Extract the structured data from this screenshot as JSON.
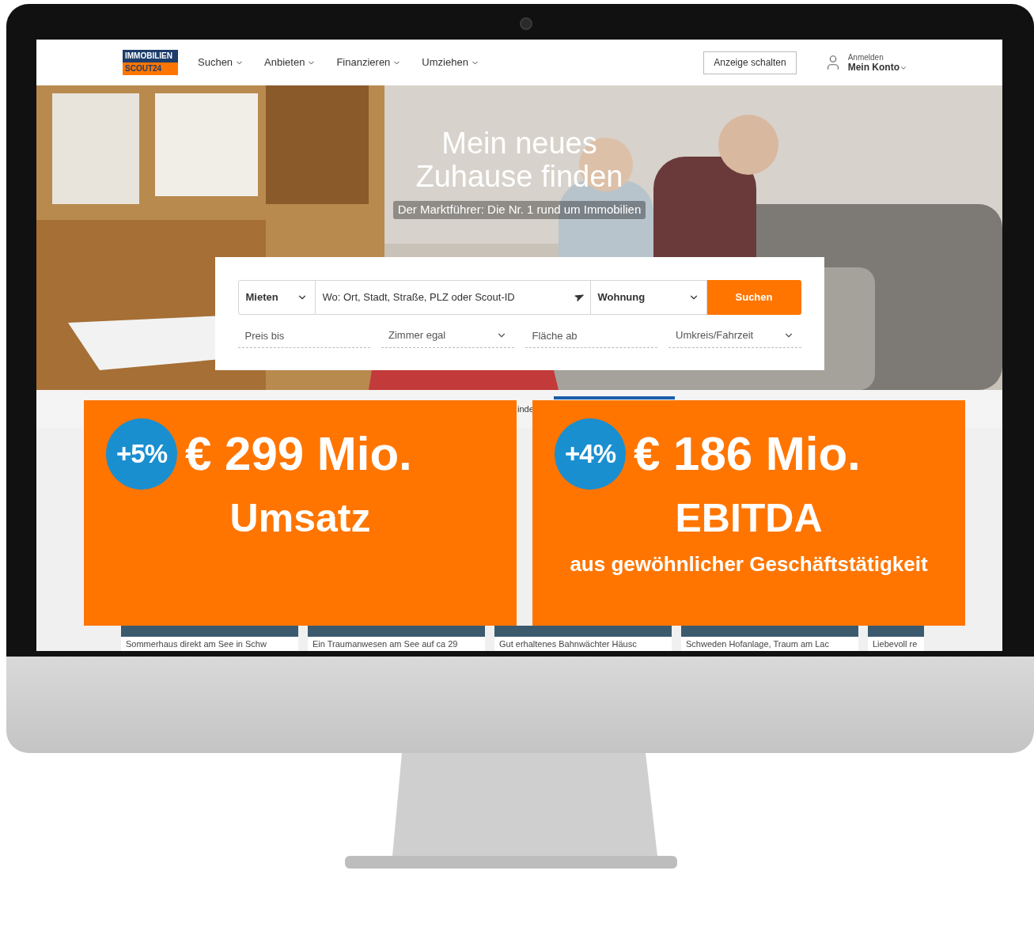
{
  "logo": {
    "line_1": "IMMOBILIEN",
    "line_2": "SCOUT24"
  },
  "nav": [
    {
      "label": "Suchen"
    },
    {
      "label": "Anbieten"
    },
    {
      "label": "Finanzieren"
    },
    {
      "label": "Umziehen"
    }
  ],
  "header_button": "Anzeige schalten",
  "account": {
    "hint": "Anmelden",
    "label": "Mein Konto"
  },
  "hero": {
    "title_lines": [
      "Mein neues",
      "Zuhause finden"
    ],
    "subtitle": "Der Marktführer: Die Nr. 1 rund um Immobilien"
  },
  "search": {
    "mode": "Mieten",
    "location_placeholder": "Wo: Ort, Stadt, Straße, PLZ oder Scout-ID",
    "type": "Wohnung",
    "button": "Suchen",
    "filters": [
      {
        "placeholder": "Preis bis",
        "kind": "input"
      },
      {
        "label": "Zimmer egal",
        "kind": "select"
      },
      {
        "placeholder": "Fläche ab",
        "kind": "input"
      },
      {
        "label": "Umkreis/Fahrzeit",
        "kind": "select"
      }
    ]
  },
  "tab_fragment": "inde",
  "listings": [
    {
      "title": "Sommerhaus direkt am See in Schw"
    },
    {
      "title": "Ein Traumanwesen am See auf ca 29"
    },
    {
      "title": "Gut erhaltenes Bahnwächter Häusc"
    },
    {
      "title": "Schweden Hofanlage, Traum am Lac"
    },
    {
      "title": "Liebevoll re"
    }
  ],
  "overlays": [
    {
      "badge": "+5%",
      "amount": "€ 299 Mio.",
      "label": "Umsatz"
    },
    {
      "badge": "+4%",
      "amount": "€ 186 Mio.",
      "label": "EBITDA",
      "note": "aus gewöhnlicher Geschäftstätigkeit"
    }
  ]
}
